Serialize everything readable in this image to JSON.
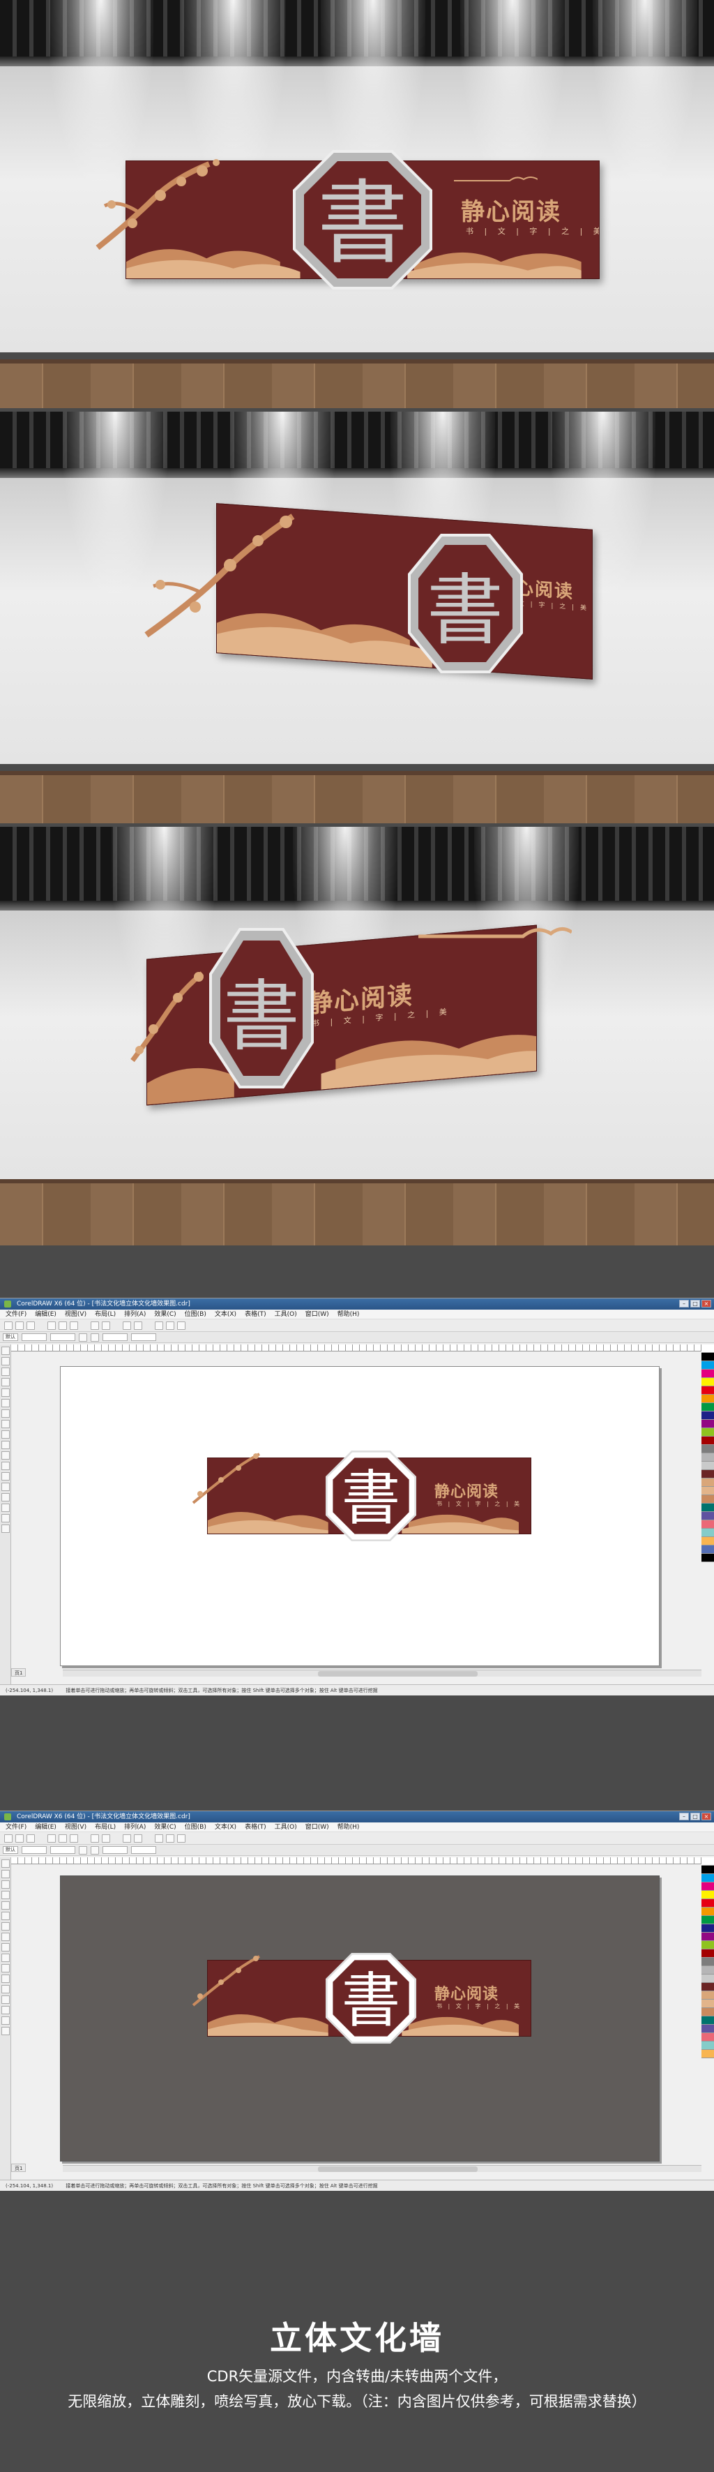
{
  "sign": {
    "glyph": "書",
    "title": "静心阅读",
    "subtitle": "书 | 文 | 字 | 之 | 美"
  },
  "software": {
    "window_title": "CorelDRAW X6 (64 位) - [书法文化墙立体文化墙效果图.cdr]",
    "menu": [
      "文件(F)",
      "编辑(E)",
      "视图(V)",
      "布局(L)",
      "排列(A)",
      "效果(C)",
      "位图(B)",
      "文本(X)",
      "表格(T)",
      "工具(O)",
      "窗口(W)",
      "帮助(H)"
    ],
    "preset": "默认",
    "page_tab": "页1",
    "status_coords": "(-254.104, 1,348.1)",
    "status_text": "接着单击可进行拖动或缩放；再单击可旋转或倾斜；双击工具，可选择所有对象；按住 Shift 键单击可选择多个对象；按住 Alt 键单击可进行挖掘"
  },
  "footer": {
    "title": "立体文化墙",
    "line1": "CDR矢量源文件，内含转曲/未转曲两个文件，",
    "line2": "无限缩放，立体雕刻，喷绘写真，放心下载。（注：内含图片仅供参考，可根据需求替换）"
  },
  "colors": {
    "panel": "#6b2525",
    "accent": "#d9a679",
    "octagon": "#b8b8b8"
  }
}
